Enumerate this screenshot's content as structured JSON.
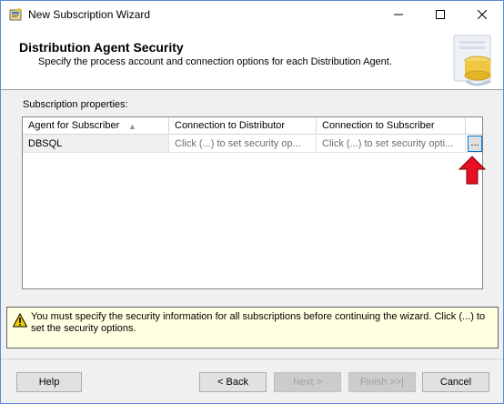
{
  "window": {
    "title": "New Subscription Wizard",
    "icons": {
      "app": "wizard-app-icon",
      "minimize": "minimize-icon",
      "maximize": "maximize-icon",
      "close": "close-icon"
    }
  },
  "header": {
    "title": "Distribution Agent Security",
    "subtitle": "Specify the process account and connection options for each Distribution Agent.",
    "art_icon": "database-wizard-icon"
  },
  "subscription_properties": {
    "label": "Subscription properties:",
    "columns": [
      "Agent for Subscriber",
      "Connection to Distributor",
      "Connection to Subscriber",
      ""
    ],
    "sort_icon": "sort-ascending-icon",
    "rows": [
      {
        "agent": "DBSQL",
        "distributor": "Click (...) to set security op...",
        "subscriber": "Click (...) to set security opti...",
        "button": "..."
      }
    ]
  },
  "annotation": {
    "icon": "red-arrow-up-icon",
    "color": "#e81123"
  },
  "warning": {
    "icon": "warning-icon",
    "text": "You must specify the security information for all subscriptions before continuing the wizard. Click (...) to set the security options."
  },
  "buttons": {
    "help": "Help",
    "back": "< Back",
    "next": "Next >",
    "finish": "Finish >>|",
    "cancel": "Cancel"
  },
  "colors": {
    "window_border": "#5a8bd4",
    "focus": "#0078d7",
    "warning_bg": "#ffffe1"
  }
}
